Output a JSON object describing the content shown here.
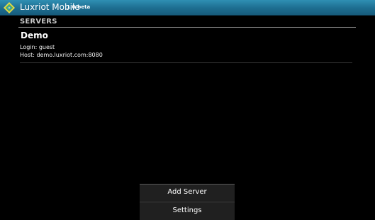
{
  "action_bar": {
    "title": "Luxriot Mobile",
    "version": "1.0-beta",
    "icon": "luxriot-logo-icon"
  },
  "servers_section": {
    "header": "SERVERS",
    "items": [
      {
        "name": "Demo",
        "login": "Login: guest",
        "host": "Host: demo.luxriot.com:8080"
      }
    ]
  },
  "menu": {
    "add_server_label": "Add Server",
    "settings_label": "Settings"
  },
  "colors": {
    "action_bar_top": "#2f8fb3",
    "action_bar_bottom": "#175c7c",
    "background": "#000000",
    "menu_background": "#202020"
  }
}
